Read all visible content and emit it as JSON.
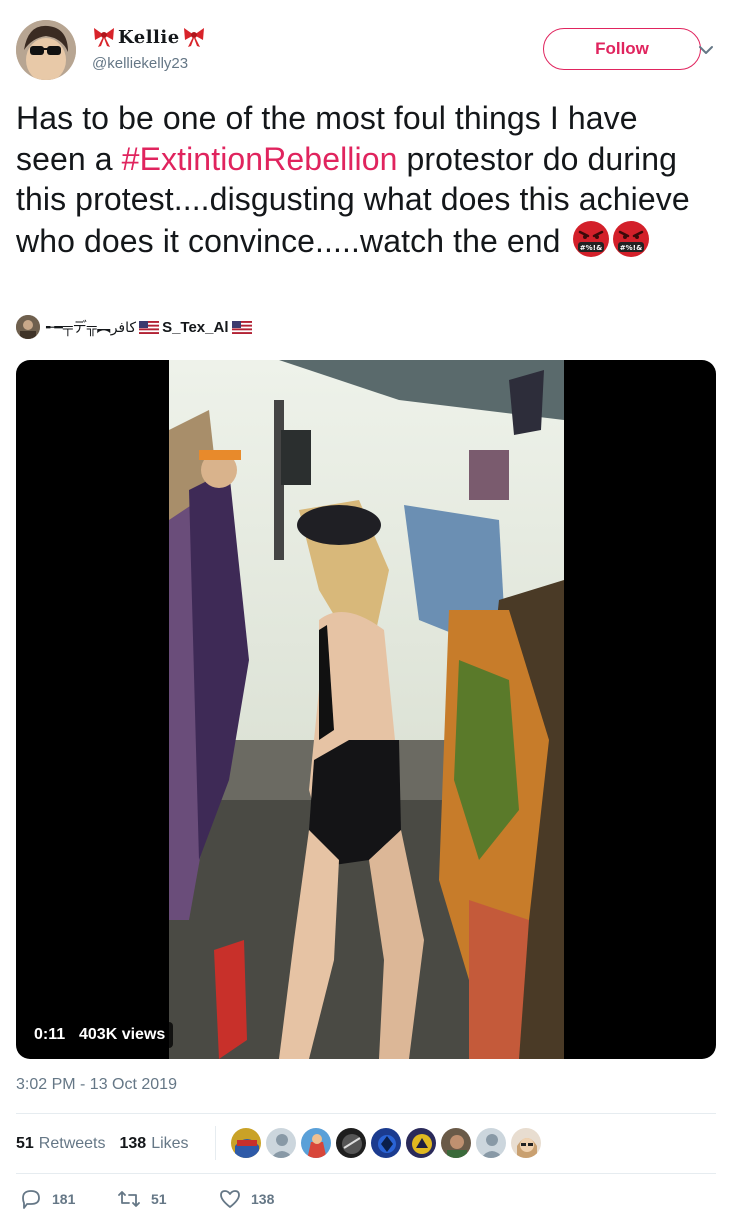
{
  "user": {
    "display_name": "Kellie",
    "handle": "@kelliekelly23",
    "avatar_icon": "profile-photo-sunglasses"
  },
  "follow_label": "Follow",
  "tweet": {
    "text_before": "Has to be one of the most foul things I have seen a ",
    "hashtag": "#ExtintionRebellion",
    "text_after": " protestor do during this protest....disgusting what does this achieve who does it convince.....watch the end ",
    "emoji_name": "face-with-symbols-on-mouth",
    "emoji_text": "#%!&"
  },
  "mention": {
    "prefix": "╾━╤デ╦︻كافر",
    "name": "S_Tex_Al"
  },
  "video": {
    "duration": "0:11",
    "views": "403K views"
  },
  "timestamp": "3:02 PM - 13 Oct 2019",
  "stats": {
    "retweets_count": "51",
    "retweets_label": "Retweets",
    "likes_count": "138",
    "likes_label": "Likes"
  },
  "actions": {
    "replies": "181",
    "retweets": "51",
    "likes": "138"
  },
  "colors": {
    "accent": "#e0245e",
    "muted": "#657786",
    "divider": "#e6ecf0"
  }
}
